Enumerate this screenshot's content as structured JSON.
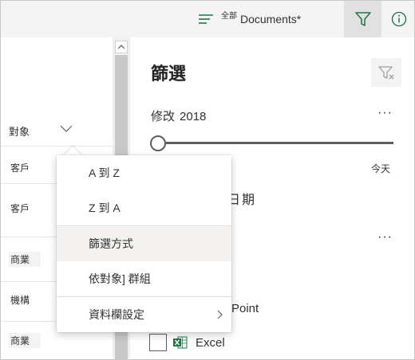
{
  "topbar": {
    "view_all_label": "全部",
    "view_name": "Documents*",
    "icons": {
      "view": "view-lines-icon",
      "filter": "filter-icon",
      "info": "info-icon"
    },
    "accent_color": "#217346",
    "active_bg": "#e1e1e1"
  },
  "list": {
    "column_header": "對象",
    "rows": [
      "客戶",
      "客戶",
      "商業",
      "機構",
      "商業"
    ]
  },
  "panel": {
    "title": "篩選",
    "section_title_a": "修改",
    "section_title_b": "2018",
    "slider_end_label": "今天",
    "slider_value": 0,
    "partial_date_text": "日期",
    "partial_pp_text": "rPoint",
    "excel_label": "Excel",
    "more_glyph": "···"
  },
  "menu": {
    "items": [
      "A 到 Z",
      "Z 到 A",
      "篩選方式",
      "依對象] 群組",
      "資料欄設定"
    ],
    "highlighted_index": 2
  }
}
